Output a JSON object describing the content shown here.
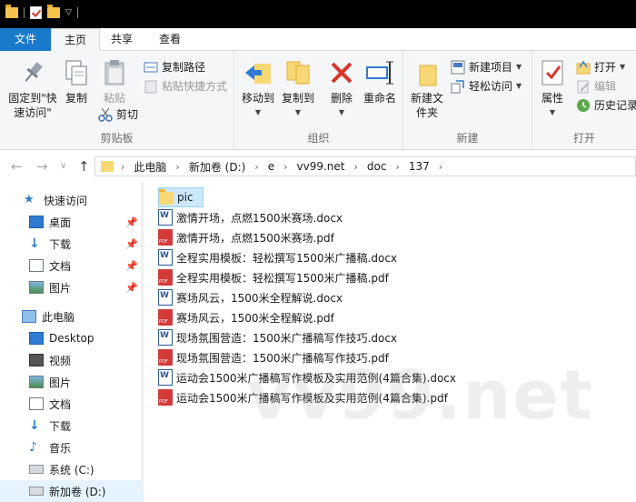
{
  "ribbon_tabs": {
    "file": "文件",
    "home": "主页",
    "share": "共享",
    "view": "查看"
  },
  "clipboard": {
    "pin": "固定到\"快速访问\"",
    "copy": "复制",
    "paste": "粘贴",
    "copy_path": "复制路径",
    "paste_shortcut": "粘贴快捷方式",
    "cut": "剪切",
    "label": "剪贴板"
  },
  "organize": {
    "move_to": "移动到",
    "copy_to": "复制到",
    "delete": "删除",
    "rename": "重命名",
    "label": "组织"
  },
  "new_group": {
    "new_folder": "新建文件夹",
    "new_item": "新建项目",
    "easy_access": "轻松访问",
    "label": "新建"
  },
  "open_group": {
    "properties": "属性",
    "open": "打开",
    "edit": "编辑",
    "history": "历史记录",
    "label": "打开"
  },
  "breadcrumb": [
    "此电脑",
    "新加卷 (D:)",
    "e",
    "vv99.net",
    "doc",
    "137"
  ],
  "nav": {
    "quick_access": "快速访问",
    "quick_items": [
      "桌面",
      "下载",
      "文档",
      "图片"
    ],
    "this_pc": "此电脑",
    "pc_items": [
      "Desktop",
      "视频",
      "图片",
      "文档",
      "下载",
      "音乐",
      "系统 (C:)",
      "新加卷 (D:)"
    ]
  },
  "files": [
    {
      "name": "pic",
      "type": "folder"
    },
    {
      "name": "激情开场，点燃1500米赛场.docx",
      "type": "docx"
    },
    {
      "name": "激情开场，点燃1500米赛场.pdf",
      "type": "pdf"
    },
    {
      "name": "全程实用模板：轻松撰写1500米广播稿.docx",
      "type": "docx"
    },
    {
      "name": "全程实用模板：轻松撰写1500米广播稿.pdf",
      "type": "pdf"
    },
    {
      "name": "赛场风云，1500米全程解说.docx",
      "type": "docx"
    },
    {
      "name": "赛场风云，1500米全程解说.pdf",
      "type": "pdf"
    },
    {
      "name": "现场氛围营造：1500米广播稿写作技巧.docx",
      "type": "docx"
    },
    {
      "name": "现场氛围营造：1500米广播稿写作技巧.pdf",
      "type": "pdf"
    },
    {
      "name": "运动会1500米广播稿写作模板及实用范例(4篇合集).docx",
      "type": "docx"
    },
    {
      "name": "运动会1500米广播稿写作模板及实用范例(4篇合集).pdf",
      "type": "pdf"
    }
  ],
  "watermark": "vv99.net",
  "colors": {
    "accent": "#1979ca",
    "folder": "#f8d775",
    "pdf": "#d33a3a",
    "word": "#2b5797",
    "selection": "#cce8ff"
  }
}
